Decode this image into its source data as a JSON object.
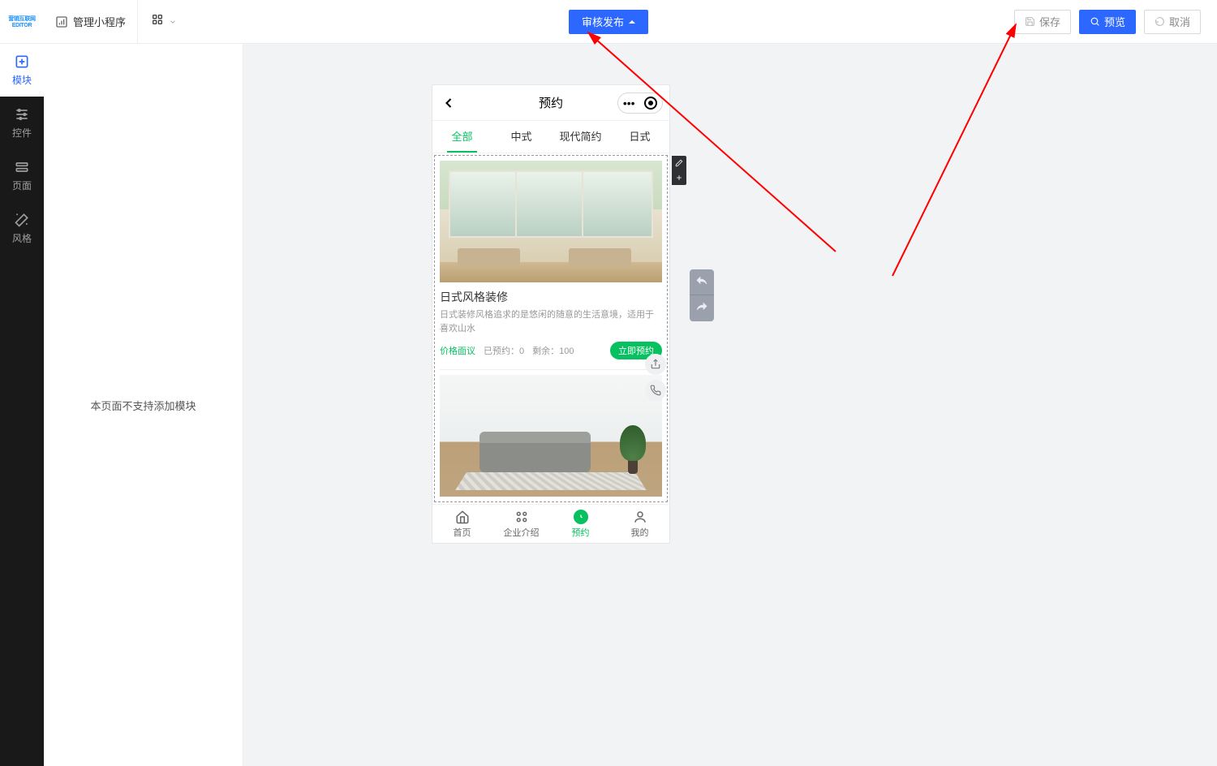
{
  "topbar": {
    "logo_text": "营销互联网 EDITOR",
    "manage_label": "管理小程序",
    "audit_publish_label": "审核发布",
    "save_label": "保存",
    "preview_label": "预览",
    "cancel_label": "取消"
  },
  "rail": {
    "items": [
      {
        "label": "模块"
      },
      {
        "label": "控件"
      },
      {
        "label": "页面"
      },
      {
        "label": "风格"
      }
    ]
  },
  "side_panel": {
    "empty_text": "本页面不支持添加模块"
  },
  "phone": {
    "nav_title": "预约",
    "tabs": [
      "全部",
      "中式",
      "现代简约",
      "日式"
    ],
    "card1": {
      "title": "日式风格装修",
      "desc": "日式装修风格追求的是悠闲的随意的生活意境，适用于喜欢山水",
      "price": "价格面议",
      "booked_label": "已预约：",
      "booked_value": "0",
      "remain_label": "剩余：",
      "remain_value": "100",
      "btn": "立即预约"
    },
    "tabbar": [
      {
        "label": "首页"
      },
      {
        "label": "企业介绍"
      },
      {
        "label": "预约"
      },
      {
        "label": "我的"
      }
    ]
  }
}
